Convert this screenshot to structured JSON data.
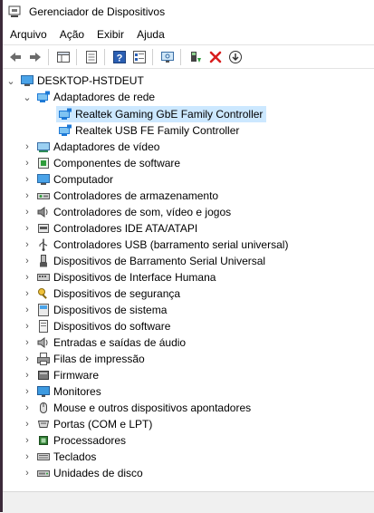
{
  "window": {
    "title": "Gerenciador de Dispositivos"
  },
  "menu": [
    "Arquivo",
    "Ação",
    "Exibir",
    "Ajuda"
  ],
  "toolbar": [
    "back-icon",
    "forward-icon",
    "properties-view-icon",
    "list-icon",
    "help-icon",
    "details-icon",
    "monitor-scan-icon",
    "update-driver-icon",
    "uninstall-icon",
    "download-icon"
  ],
  "tree": {
    "root": "DESKTOP-HSTDEUT",
    "network": {
      "label": "Adaptadores de rede",
      "children": [
        "Realtek Gaming GbE Family Controller",
        "Realtek USB FE Family Controller"
      ]
    },
    "categories": [
      {
        "label": "Adaptadores de vídeo",
        "icon": "display-adapter-icon"
      },
      {
        "label": "Componentes de software",
        "icon": "software-component-icon"
      },
      {
        "label": "Computador",
        "icon": "computer-icon"
      },
      {
        "label": "Controladores de armazenamento",
        "icon": "storage-controller-icon"
      },
      {
        "label": "Controladores de som, vídeo e jogos",
        "icon": "sound-icon"
      },
      {
        "label": "Controladores IDE ATA/ATAPI",
        "icon": "ide-icon"
      },
      {
        "label": "Controladores USB (barramento serial universal)",
        "icon": "usb-icon"
      },
      {
        "label": "Dispositivos de Barramento Serial Universal",
        "icon": "usb-device-icon"
      },
      {
        "label": "Dispositivos de Interface Humana",
        "icon": "hid-icon"
      },
      {
        "label": "Dispositivos de segurança",
        "icon": "security-key-icon"
      },
      {
        "label": "Dispositivos de sistema",
        "icon": "system-device-icon"
      },
      {
        "label": "Dispositivos do software",
        "icon": "software-device-icon"
      },
      {
        "label": "Entradas e saídas de áudio",
        "icon": "speaker-icon"
      },
      {
        "label": "Filas de impressão",
        "icon": "printer-icon"
      },
      {
        "label": "Firmware",
        "icon": "firmware-icon"
      },
      {
        "label": "Monitores",
        "icon": "monitor-icon"
      },
      {
        "label": "Mouse e outros dispositivos apontadores",
        "icon": "mouse-icon"
      },
      {
        "label": "Portas (COM e LPT)",
        "icon": "port-icon"
      },
      {
        "label": "Processadores",
        "icon": "processor-icon"
      },
      {
        "label": "Teclados",
        "icon": "keyboard-icon"
      },
      {
        "label": "Unidades de disco",
        "icon": "disk-drive-icon"
      }
    ]
  },
  "colors": {
    "selection": "#cce8ff",
    "netBlue": "#1e7ad6",
    "red": "#d81e1e",
    "green": "#2e9e3a"
  }
}
